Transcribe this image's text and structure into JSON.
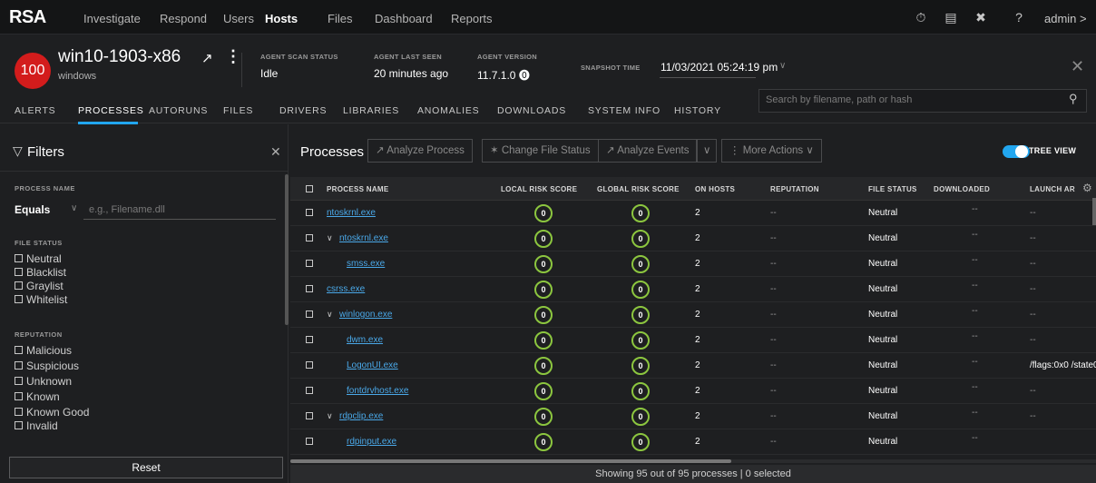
{
  "app": {
    "logo": "RSA"
  },
  "topnav": {
    "items": [
      "Investigate",
      "Respond",
      "Users",
      "Hosts",
      "Files",
      "Dashboard",
      "Reports"
    ],
    "active": "Hosts",
    "user": "admin >",
    "icons": [
      "timer-icon",
      "notes-icon",
      "tools-icon",
      "help-icon"
    ]
  },
  "host": {
    "risk_score": "100",
    "name": "win10-1903-x86",
    "os": "windows",
    "meta": [
      {
        "label": "AGENT SCAN STATUS",
        "value": "Idle"
      },
      {
        "label": "AGENT LAST SEEN",
        "value": "20 minutes ago"
      },
      {
        "label": "AGENT VERSION",
        "value": "11.7.1.0 ⓿"
      }
    ],
    "snapshot_label": "SNAPSHOT TIME",
    "snapshot_value": "11/03/2021 05:24:19 pm",
    "risk_color": "#d31c1c"
  },
  "tabs": [
    "ALERTS",
    "PROCESSES",
    "AUTORUNS",
    "FILES",
    "DRIVERS",
    "LIBRARIES",
    "ANOMALIES",
    "DOWNLOADS",
    "SYSTEM INFO",
    "HISTORY"
  ],
  "active_tab": "PROCESSES",
  "search": {
    "placeholder": "Search by filename, path or hash"
  },
  "filters": {
    "title": "Filters",
    "process_name_label": "PROCESS NAME",
    "operator": "Equals",
    "input_placeholder": "e.g., Filename.dll",
    "file_status_label": "FILE STATUS",
    "file_status_options": [
      "Neutral",
      "Blacklist",
      "Graylist",
      "Whitelist"
    ],
    "reputation_label": "REPUTATION",
    "reputation_options": [
      "Malicious",
      "Suspicious",
      "Unknown",
      "Known",
      "Known Good",
      "Invalid"
    ],
    "reset_label": "Reset"
  },
  "processes": {
    "title": "Processes",
    "buttons": {
      "analyze_process": "↗ Analyze Process",
      "change_file_status": "✶ Change File Status",
      "analyze_events": "↗ Analyze Events",
      "more_actions": "⋮ More Actions ∨"
    },
    "tree_view_label": "TREE VIEW",
    "columns": [
      "PROCESS NAME",
      "LOCAL RISK SCORE",
      "GLOBAL RISK SCORE",
      "ON HOSTS",
      "REPUTATION",
      "FILE STATUS",
      "DOWNLOADED",
      "LAUNCH AR"
    ],
    "rows": [
      {
        "name": "ntoskrnl.exe",
        "indent": 0,
        "expander": false,
        "local": "0",
        "global": "0",
        "hosts": "2",
        "reputation": "--",
        "status": "Neutral",
        "downloaded": "--",
        "launch": "--"
      },
      {
        "name": "ntoskrnl.exe",
        "indent": 0,
        "expander": true,
        "local": "0",
        "global": "0",
        "hosts": "2",
        "reputation": "--",
        "status": "Neutral",
        "downloaded": "--",
        "launch": "--"
      },
      {
        "name": "smss.exe",
        "indent": 1,
        "expander": false,
        "local": "0",
        "global": "0",
        "hosts": "2",
        "reputation": "--",
        "status": "Neutral",
        "downloaded": "--",
        "launch": "--"
      },
      {
        "name": "csrss.exe",
        "indent": 0,
        "expander": false,
        "local": "0",
        "global": "0",
        "hosts": "2",
        "reputation": "--",
        "status": "Neutral",
        "downloaded": "--",
        "launch": "--"
      },
      {
        "name": "winlogon.exe",
        "indent": 0,
        "expander": true,
        "local": "0",
        "global": "0",
        "hosts": "2",
        "reputation": "--",
        "status": "Neutral",
        "downloaded": "--",
        "launch": "--"
      },
      {
        "name": "dwm.exe",
        "indent": 1,
        "expander": false,
        "local": "0",
        "global": "0",
        "hosts": "2",
        "reputation": "--",
        "status": "Neutral",
        "downloaded": "--",
        "launch": "--"
      },
      {
        "name": "LogonUI.exe",
        "indent": 1,
        "expander": false,
        "local": "0",
        "global": "0",
        "hosts": "2",
        "reputation": "--",
        "status": "Neutral",
        "downloaded": "--",
        "launch": "/flags:0x0 /state0"
      },
      {
        "name": "fontdrvhost.exe",
        "indent": 1,
        "expander": false,
        "local": "0",
        "global": "0",
        "hosts": "2",
        "reputation": "--",
        "status": "Neutral",
        "downloaded": "--",
        "launch": "--"
      },
      {
        "name": "rdpclip.exe",
        "indent": 0,
        "expander": true,
        "local": "0",
        "global": "0",
        "hosts": "2",
        "reputation": "--",
        "status": "Neutral",
        "downloaded": "--",
        "launch": "--"
      },
      {
        "name": "rdpinput.exe",
        "indent": 1,
        "expander": false,
        "local": "0",
        "global": "0",
        "hosts": "2",
        "reputation": "--",
        "status": "Neutral",
        "downloaded": "--",
        "launch": ""
      }
    ],
    "footer": "Showing 95 out of 95 processes | 0 selected",
    "score_color": "#8cc63f",
    "accent": "#22a6ef"
  }
}
